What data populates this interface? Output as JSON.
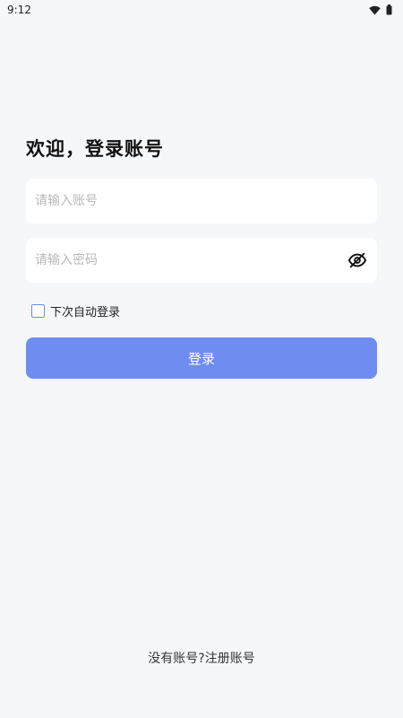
{
  "status_bar": {
    "time": "9:12",
    "icons": [
      "wifi-icon",
      "battery-icon"
    ]
  },
  "login": {
    "title": "欢迎，登录账号",
    "account_placeholder": "请输入账号",
    "account_value": "",
    "password_placeholder": "请输入密码",
    "password_value": "",
    "toggle_icon": "eye-off-icon",
    "remember_label": "下次自动登录",
    "remember_checked": false,
    "login_label": "登录",
    "register_text": "没有账号?注册账号"
  },
  "colors": {
    "background": "#f6f7f9",
    "primary": "#6f8cf1",
    "field_background": "#ffffff"
  }
}
